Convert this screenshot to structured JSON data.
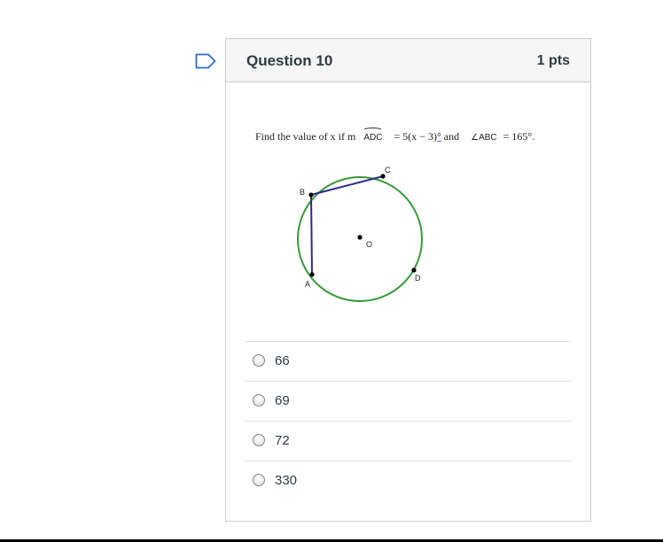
{
  "question": {
    "title": "Question 10",
    "points": "1 pts",
    "text_prefix": "Find the value of x if m",
    "arc_name": "ADC",
    "text_equals": "= 5(x − 3)",
    "text_degree": "°",
    "text_and": " and",
    "angle_symbol": "∠",
    "angle_name": "ABC",
    "text_suffix": "= 165°."
  },
  "figure": {
    "points": {
      "B": "B",
      "C": "C",
      "O": "O",
      "D": "D",
      "A": "A"
    },
    "circle_color": "#3a9a3a",
    "chord_color": "#2c2c8c"
  },
  "answers": [
    {
      "label": "66",
      "selected": false
    },
    {
      "label": "69",
      "selected": false
    },
    {
      "label": "72",
      "selected": false
    },
    {
      "label": "330",
      "selected": false
    }
  ],
  "icons": {
    "flag": "flag-outline-icon"
  },
  "colors": {
    "flag": "#2e6ad1",
    "header_bg": "#f5f5f5",
    "border": "#c7cdd1"
  }
}
